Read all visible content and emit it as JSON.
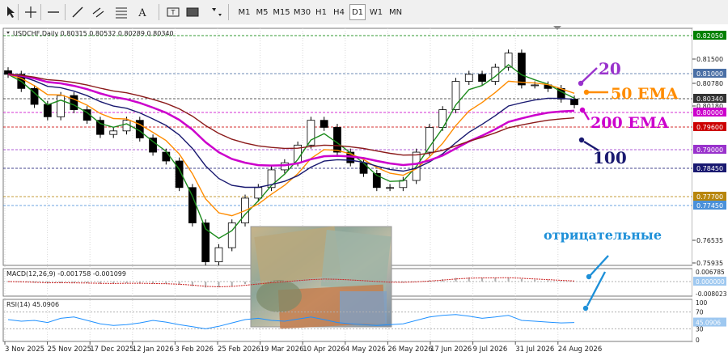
{
  "toolbar": {
    "timeframes": [
      "M1",
      "M5",
      "M15",
      "M30",
      "H1",
      "H4",
      "D1",
      "W1",
      "MN"
    ],
    "active_timeframe": "D1",
    "tools": [
      {
        "name": "cursor-icon"
      },
      {
        "name": "crosshair-icon"
      },
      {
        "name": "horizontal-line-icon"
      },
      {
        "name": "trendline-icon"
      },
      {
        "name": "equidistant-channel-icon"
      },
      {
        "name": "fibonacci-icon"
      },
      {
        "name": "text-icon"
      },
      {
        "name": "text-label-icon"
      },
      {
        "name": "rectangle-icon"
      },
      {
        "name": "shapes-menu-icon"
      }
    ]
  },
  "chart_data": {
    "type": "candlestick",
    "symbol_header": "USDCHF,Daily  0.80315 0.80532 0.80289 0.80340",
    "price_axis": [
      "0.82050",
      "0.81500",
      "0.81000",
      "0.80780",
      "0.80340",
      "0.80180",
      "0.80000",
      "0.79600",
      "0.79000",
      "0.78450",
      "0.77700",
      "0.77450",
      "0.76535",
      "0.75935"
    ],
    "price_highlight_colors": {
      "0.82050": "#008000",
      "0.81000": "#4a6fa5",
      "0.80340": "#333333",
      "0.80000": "#cc00cc",
      "0.79600": "#cc0000",
      "0.79000": "#9932cc",
      "0.78450": "#191970",
      "0.77700": "#b8860b",
      "0.77450": "#4a90d9"
    },
    "date_labels": [
      "3 Nov 2025",
      "25 Nov 2025",
      "17 Dec 2025",
      "12 Jan 2026",
      "3 Feb 2026",
      "25 Feb 2026",
      "19 Mar 2026",
      "10 Apr 2026",
      "4 May 2026",
      "26 May 2026",
      "17 Jun 2026",
      "9 Jul 2026",
      "31 Jul 2026",
      "24 Aug 2026"
    ],
    "close_series": [
      0.812,
      0.808,
      0.8035,
      0.8,
      0.806,
      0.802,
      0.799,
      0.795,
      0.796,
      0.799,
      0.794,
      0.79,
      0.7875,
      0.78,
      0.77,
      0.759,
      0.763,
      0.77,
      0.777,
      0.78,
      0.785,
      0.787,
      0.792,
      0.799,
      0.797,
      0.79,
      0.787,
      0.784,
      0.78,
      0.78,
      0.782,
      0.79,
      0.797,
      0.802,
      0.81,
      0.812,
      0.81,
      0.814,
      0.818,
      0.809,
      0.809,
      0.808,
      0.805,
      0.8034
    ],
    "ma_series": [
      {
        "name": "EMA 20",
        "color": "#1a8a1a",
        "period": 3
      },
      {
        "name": "EMA 50",
        "color": "#ff8c00",
        "period": 6
      },
      {
        "name": "100",
        "color": "#191970",
        "period": 12
      },
      {
        "name": "EMA 200",
        "color": "#cc00cc",
        "period": 20
      },
      {
        "name": "",
        "color": "#8b1a1a",
        "period": 30
      }
    ],
    "macd": {
      "label": "MACD(12,26,9) -0.001758 -0.001099",
      "axis": [
        "0.006785",
        "0.000000",
        "-0.008023"
      ]
    },
    "rsi": {
      "label": "RSI(14) 45.0906",
      "axis": [
        "100",
        "70",
        "45.0906",
        "30",
        "0"
      ],
      "values": [
        52,
        48,
        50,
        45,
        55,
        58,
        50,
        42,
        38,
        40,
        44,
        50,
        46,
        40,
        35,
        30,
        36,
        44,
        52,
        55,
        50,
        48,
        53,
        58,
        52,
        45,
        42,
        40,
        38,
        40,
        42,
        50,
        58,
        62,
        64,
        60,
        55,
        58,
        62,
        50,
        48,
        46,
        44,
        45
      ]
    },
    "annotations": [
      {
        "text": "20",
        "color": "#9932cc"
      },
      {
        "text": "50 EMA",
        "color": "#ff8c00"
      },
      {
        "text": "200 EMA",
        "color": "#cc00cc"
      },
      {
        "text": "100",
        "color": "#191970"
      },
      {
        "text": "отрицательные",
        "color": "#1e90d8"
      }
    ]
  }
}
